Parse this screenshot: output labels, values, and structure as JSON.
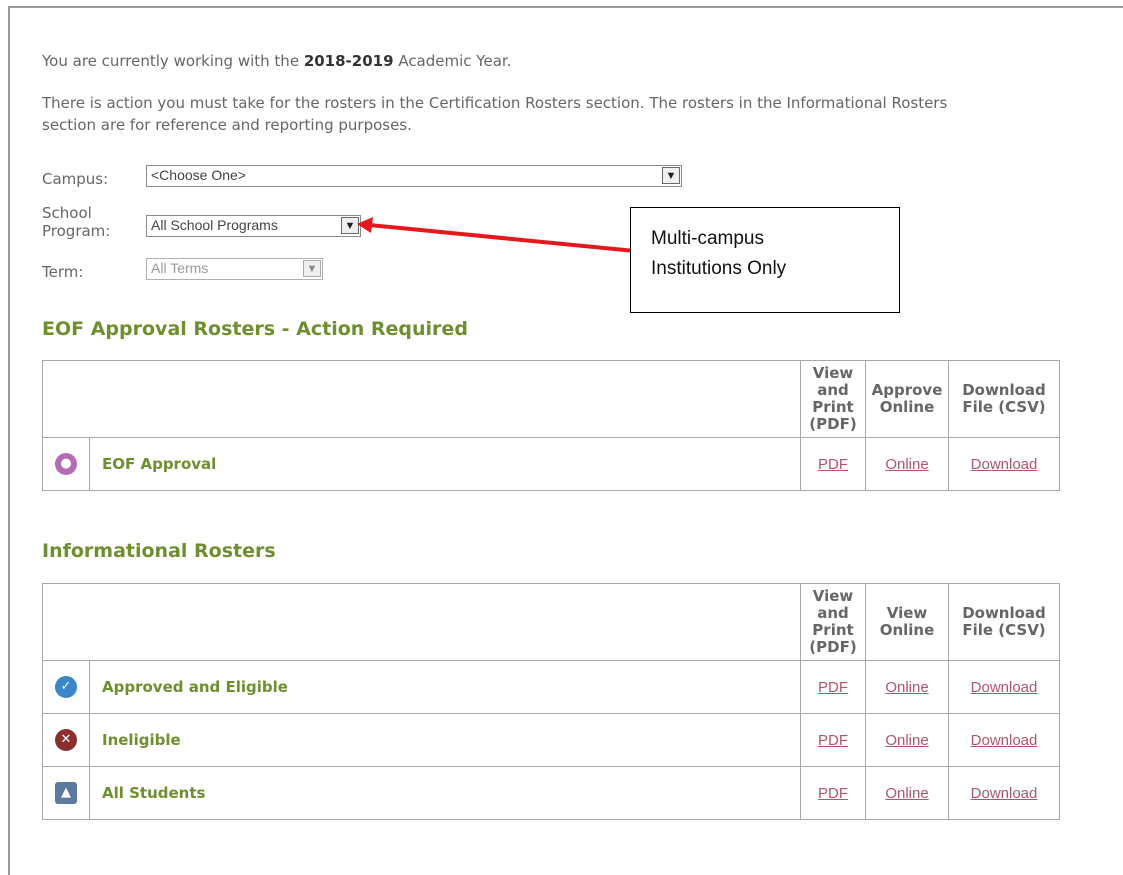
{
  "intro": {
    "prefix": "You are currently working with the ",
    "year": "2018-2019",
    "suffix": " Academic Year."
  },
  "description": "There is action you must take for the rosters in the Certification Rosters section. The rosters in the Informational Rosters section are for reference and reporting purposes.",
  "filters": {
    "campus": {
      "label": "Campus:",
      "value": "<Choose One>"
    },
    "school_program": {
      "label_line1": "School",
      "label_line2": "Program:",
      "value": "All School Programs"
    },
    "term": {
      "label": "Term:",
      "value": "All Terms"
    }
  },
  "annotation": {
    "line1": "Multi-campus",
    "line2": "Institutions Only",
    "color": "#e8171b"
  },
  "approval": {
    "title": "EOF Approval Rosters - Action Required",
    "headers": {
      "col1": [
        "View",
        "and",
        "Print",
        "(PDF)"
      ],
      "col2": [
        "Approve",
        "Online"
      ],
      "col3": [
        "Download",
        "File (CSV)"
      ]
    },
    "rows": [
      {
        "icon": "lightbulb-icon",
        "name": "EOF Approval",
        "pdf": "PDF",
        "online": "Online",
        "download": "Download"
      }
    ]
  },
  "informational": {
    "title": "Informational Rosters",
    "headers": {
      "col1": [
        "View",
        "and",
        "Print",
        "(PDF)"
      ],
      "col2": [
        "View",
        "Online"
      ],
      "col3": [
        "Download",
        "File (CSV)"
      ]
    },
    "rows": [
      {
        "icon": "checkmark-icon",
        "name": "Approved and Eligible",
        "pdf": "PDF",
        "online": "Online",
        "download": "Download"
      },
      {
        "icon": "x-circle-icon",
        "name": "Ineligible",
        "pdf": "PDF",
        "online": "Online",
        "download": "Download"
      },
      {
        "icon": "student-icon",
        "name": "All Students",
        "pdf": "PDF",
        "online": "Online",
        "download": "Download"
      }
    ]
  },
  "colors": {
    "section_green": "#6e8f2e",
    "link_pink": "#b0556b"
  }
}
